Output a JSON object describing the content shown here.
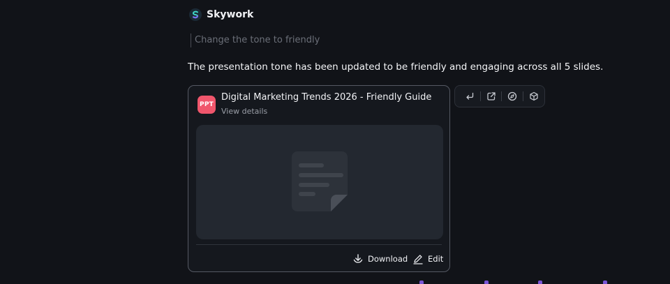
{
  "brand": {
    "name": "Skywork",
    "logo_icon": "skywork-logo-icon"
  },
  "conversation": {
    "user_prompt": "Change the tone to friendly",
    "response_text": "The presentation tone has been updated to be friendly and engaging across all 5 slides."
  },
  "card": {
    "badge": "PPT",
    "title": "Digital Marketing Trends 2026 - Friendly Guide",
    "subtitle": "View details",
    "preview_icon": "document-icon",
    "download_label": "Download",
    "edit_label": "Edit"
  },
  "toolbar": {
    "icons": [
      "reply-arrow-icon",
      "share-external-icon",
      "compass-icon",
      "cube-icon"
    ]
  },
  "colors": {
    "background": "#111318",
    "ppt_badge": "#f0566c",
    "card_border": "#555963",
    "accent_dots": "#7a55d6"
  }
}
